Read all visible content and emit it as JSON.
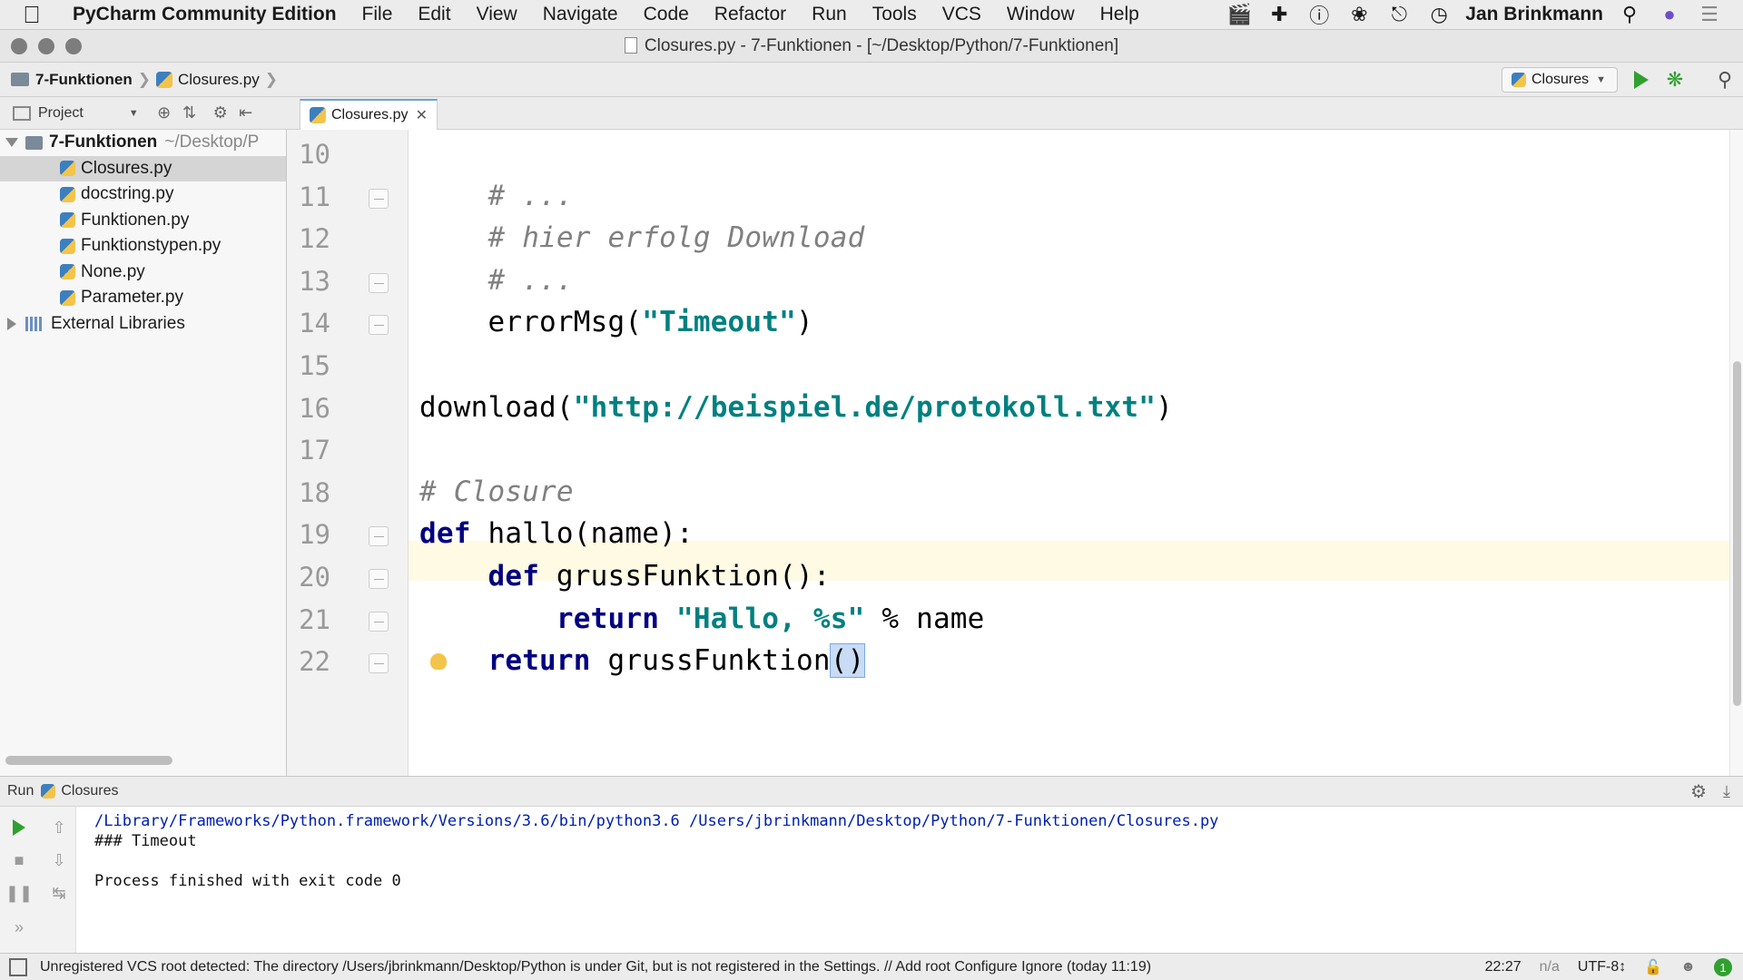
{
  "menubar": {
    "apple": "",
    "app_name": "PyCharm Community Edition",
    "items": [
      "File",
      "Edit",
      "View",
      "Navigate",
      "Code",
      "Refactor",
      "Run",
      "Tools",
      "VCS",
      "Window",
      "Help"
    ],
    "user": "Jan Brinkmann",
    "icons": [
      "clapper-icon",
      "plus-icon",
      "info-icon",
      "leaf-icon",
      "headphones-icon",
      "clock-icon",
      "search-icon",
      "siri-icon",
      "list-icon"
    ]
  },
  "window": {
    "title": "Closures.py - 7-Funktionen - [~/Desktop/Python/7-Funktionen]"
  },
  "navbar": {
    "folder": "7-Funktionen",
    "file": "Closures.py",
    "run_config": "Closures"
  },
  "project": {
    "header": "Project",
    "root_name": "7-Funktionen",
    "root_path": "~/Desktop/P",
    "files": [
      "Closures.py",
      "docstring.py",
      "Funktionen.py",
      "Funktionstypen.py",
      "None.py",
      "Parameter.py"
    ],
    "external": "External Libraries"
  },
  "editor": {
    "tab": "Closures.py",
    "lines": [
      {
        "num": "10",
        "tokens": []
      },
      {
        "num": "11",
        "tokens": [
          {
            "t": "    "
          },
          {
            "t": "# ...",
            "c": "cm"
          }
        ]
      },
      {
        "num": "12",
        "tokens": [
          {
            "t": "    "
          },
          {
            "t": "# hier erfolg Download",
            "c": "cm"
          }
        ]
      },
      {
        "num": "13",
        "tokens": [
          {
            "t": "    "
          },
          {
            "t": "# ...",
            "c": "cm"
          }
        ]
      },
      {
        "num": "14",
        "tokens": [
          {
            "t": "    errorMsg("
          },
          {
            "t": "\"Timeout\"",
            "c": "str"
          },
          {
            "t": ")"
          }
        ]
      },
      {
        "num": "15",
        "tokens": []
      },
      {
        "num": "16",
        "tokens": [
          {
            "t": "download("
          },
          {
            "t": "\"http://beispiel.de/protokoll.txt\"",
            "c": "str"
          },
          {
            "t": ")"
          }
        ]
      },
      {
        "num": "17",
        "tokens": []
      },
      {
        "num": "18",
        "tokens": [
          {
            "t": "# Closure",
            "c": "cm"
          }
        ]
      },
      {
        "num": "19",
        "tokens": [
          {
            "t": "def",
            "c": "kw"
          },
          {
            "t": " hallo(name):"
          }
        ]
      },
      {
        "num": "20",
        "tokens": [
          {
            "t": "    "
          },
          {
            "t": "def",
            "c": "kw"
          },
          {
            "t": " grussFunktion():"
          }
        ]
      },
      {
        "num": "21",
        "tokens": [
          {
            "t": "        "
          },
          {
            "t": "return",
            "c": "kw"
          },
          {
            "t": " "
          },
          {
            "t": "\"Hallo, %s\"",
            "c": "str"
          },
          {
            "t": " % name"
          }
        ]
      },
      {
        "num": "22",
        "tokens": [
          {
            "t": "    "
          },
          {
            "t": "return",
            "c": "kw"
          },
          {
            "t": " grussFunktion"
          },
          {
            "t": "()",
            "c": "hl"
          }
        ]
      }
    ]
  },
  "run_panel": {
    "label": "Run",
    "config": "Closures",
    "output": [
      "/Library/Frameworks/Python.framework/Versions/3.6/bin/python3.6 /Users/jbrinkmann/Desktop/Python/7-Funktionen/Closures.py",
      "### Timeout",
      "",
      "Process finished with exit code 0"
    ]
  },
  "statusbar": {
    "message": "Unregistered VCS root detected: The directory /Users/jbrinkmann/Desktop/Python is under Git, but is not registered in the Settings. // Add root  Configure  Ignore (today 11:19)",
    "position": "22:27",
    "na": "n/a",
    "encoding": "UTF-8↕",
    "badge": "1"
  },
  "colors": {
    "keyword": "#000080",
    "string": "#008080",
    "comment": "#808080",
    "run_green": "#30a030",
    "current_line": "#fffae3"
  }
}
